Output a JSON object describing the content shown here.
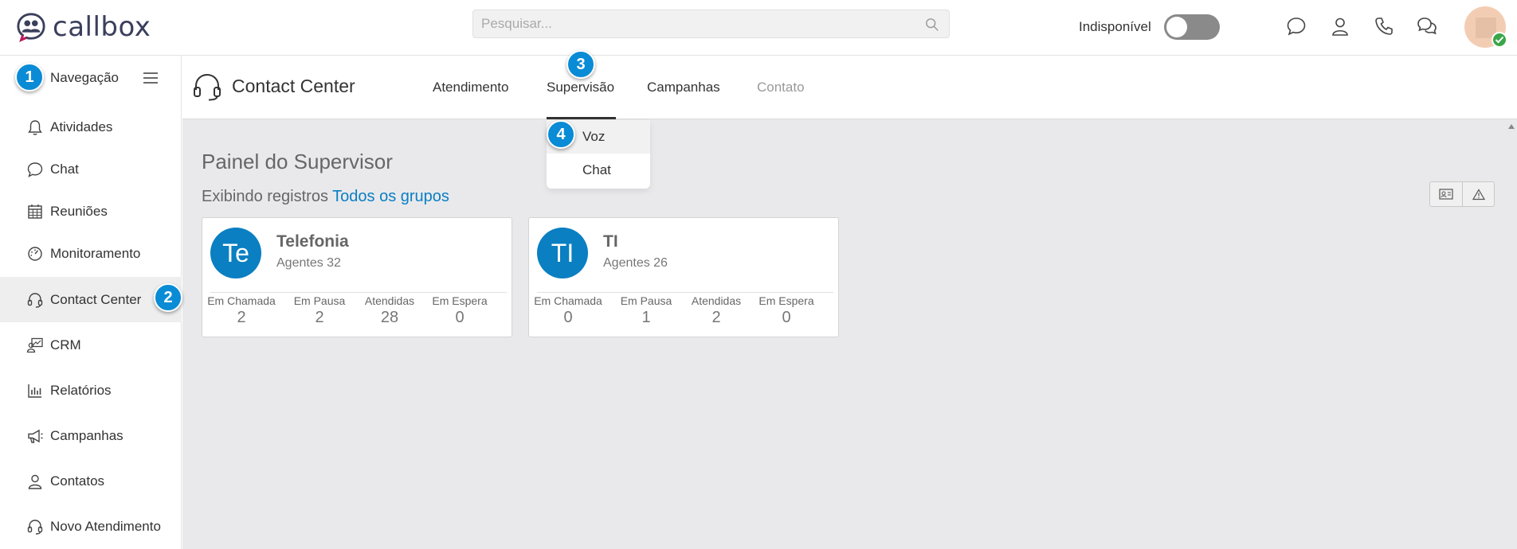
{
  "header": {
    "logo_text": "callbox",
    "search_placeholder": "Pesquisar...",
    "status_label": "Indisponível",
    "status_toggle_on": false,
    "icons": [
      "chat-bubble-icon",
      "user-icon",
      "phone-icon",
      "conversations-icon"
    ]
  },
  "sidebar": {
    "nav_title": "Navegação",
    "items": [
      {
        "label": "Atividades",
        "icon": "bell-icon"
      },
      {
        "label": "Chat",
        "icon": "chat-bubble-icon"
      },
      {
        "label": "Reuniões",
        "icon": "calendar-icon"
      },
      {
        "label": "Monitoramento",
        "icon": "dashboard-icon"
      },
      {
        "label": "Contact Center",
        "icon": "headset-icon",
        "active": true
      },
      {
        "label": "CRM",
        "icon": "crm-icon"
      },
      {
        "label": "Relatórios",
        "icon": "bar-chart-icon"
      },
      {
        "label": "Campanhas",
        "icon": "megaphone-icon"
      },
      {
        "label": "Contatos",
        "icon": "user-icon"
      },
      {
        "label": "Novo Atendimento",
        "icon": "headset-icon"
      }
    ]
  },
  "main": {
    "section_title": "Contact Center",
    "tabs": [
      {
        "label": "Atendimento"
      },
      {
        "label": "Supervisão",
        "active": true
      },
      {
        "label": "Campanhas"
      },
      {
        "label": "Contato",
        "disabled": true
      }
    ],
    "supervision_menu": [
      {
        "label": "Voz"
      },
      {
        "label": "Chat"
      }
    ],
    "panel_title": "Painel do Supervisor",
    "records_prefix": "Exibindo registros",
    "records_filter": "Todos os grupos",
    "cards": [
      {
        "initials": "Te",
        "name": "Telefonia",
        "agents": "Agentes 32",
        "stats": [
          {
            "label": "Em Chamada",
            "value": "2"
          },
          {
            "label": "Em Pausa",
            "value": "2"
          },
          {
            "label": "Atendidas",
            "value": "28"
          },
          {
            "label": "Em Espera",
            "value": "0"
          }
        ]
      },
      {
        "initials": "TI",
        "name": "TI",
        "agents": "Agentes 26",
        "stats": [
          {
            "label": "Em Chamada",
            "value": "0"
          },
          {
            "label": "Em Pausa",
            "value": "1"
          },
          {
            "label": "Atendidas",
            "value": "2"
          },
          {
            "label": "Em Espera",
            "value": "0"
          }
        ]
      }
    ]
  },
  "step_badges": [
    "1",
    "2",
    "3",
    "4"
  ],
  "colors": {
    "accent": "#0a7fc2",
    "badge": "#0a8bd6",
    "content_bg": "#e9e9ec",
    "status_ok": "#3aa64a"
  }
}
